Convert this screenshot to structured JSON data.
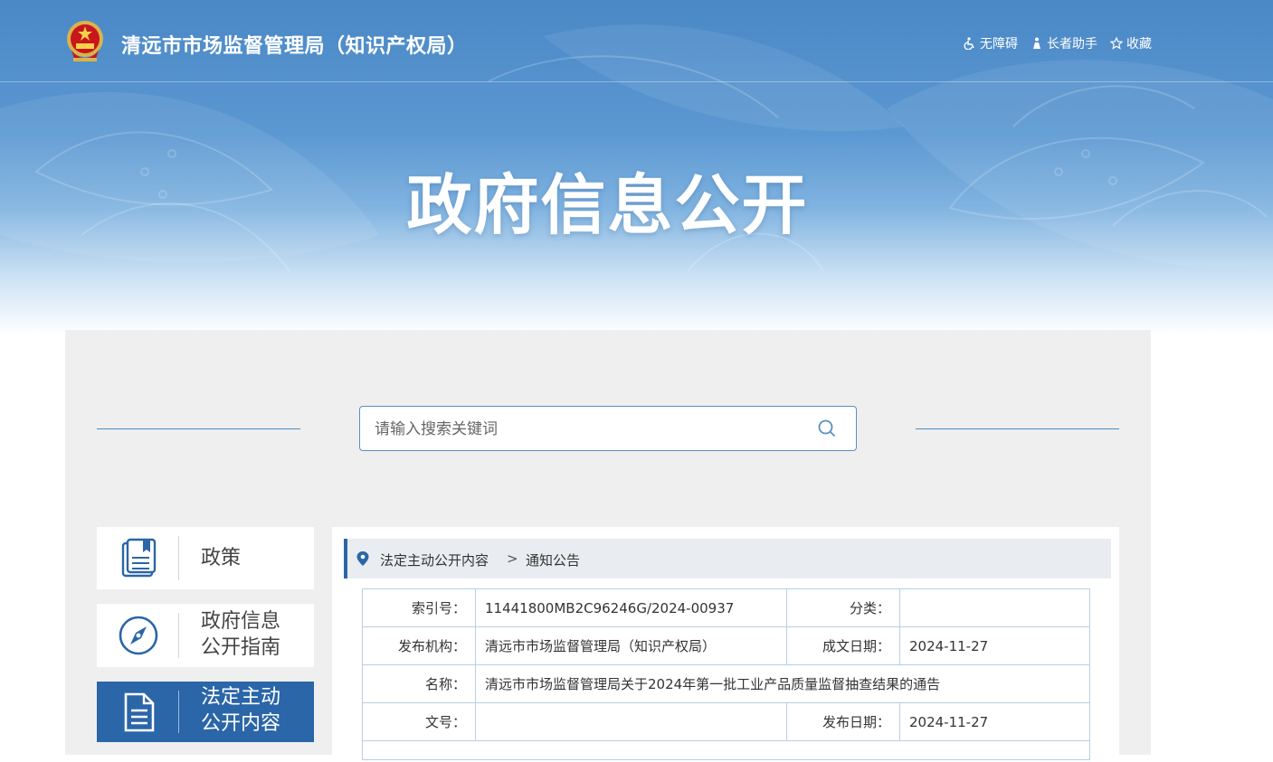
{
  "header": {
    "site_title": "清远市市场监督管理局（知识产权局）",
    "tools": [
      {
        "icon": "accessibility-icon",
        "label": "无障碍"
      },
      {
        "icon": "elder-assist-icon",
        "label": "长者助手"
      },
      {
        "icon": "star-icon",
        "label": "收藏"
      }
    ]
  },
  "banner": {
    "title": "政府信息公开"
  },
  "search": {
    "placeholder": "请输入搜索关键词"
  },
  "sidebar": {
    "items": [
      {
        "icon": "document-icon",
        "label_lines": [
          "政策"
        ],
        "active": false
      },
      {
        "icon": "compass-icon",
        "label_lines": [
          "政府信息",
          "公开指南"
        ],
        "active": false
      },
      {
        "icon": "file-list-icon",
        "label_lines": [
          "法定主动",
          "公开内容"
        ],
        "active": true
      }
    ]
  },
  "breadcrumb": {
    "items": [
      "法定主动公开内容",
      "通知公告"
    ],
    "separator": ">"
  },
  "info_table": {
    "index_label": "索引号：",
    "index_value": "11441800MB2C96246G/2024-00937",
    "category_label": "分类：",
    "category_value": "",
    "publisher_label": "发布机构：",
    "publisher_value": "清远市市场监督管理局（知识产权局）",
    "written_date_label": "成文日期：",
    "written_date_value": "2024-11-27",
    "name_label": "名称：",
    "name_value": "清远市市场监督管理局关于2024年第一批工业产品质量监督抽查结果的通告",
    "doc_no_label": "文号：",
    "doc_no_value": "",
    "publish_date_label": "发布日期：",
    "publish_date_value": "2024-11-27"
  },
  "colors": {
    "primary": "#2a66a8",
    "banner": "#5b98d2",
    "panel_bg": "#efefef",
    "table_border": "#b6d0e3"
  }
}
